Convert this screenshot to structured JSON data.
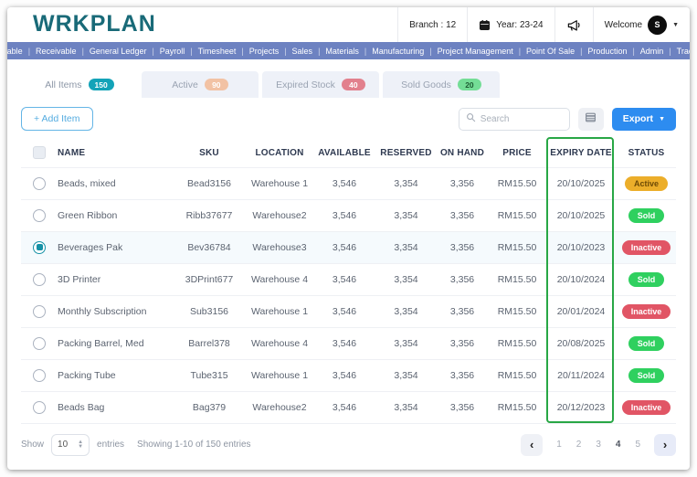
{
  "header": {
    "logo": "WRKPLAN",
    "branch": "Branch : 12",
    "year": "Year: 23-24",
    "welcome": "Welcome",
    "avatar_initial": "S"
  },
  "nav": {
    "items": [
      "Payable",
      "Receivable",
      "General Ledger",
      "Payroll",
      "Timesheet",
      "Projects",
      "Sales",
      "Materials",
      "Manufacturing",
      "Project Management",
      "Point Of Sale",
      "Production",
      "Admin",
      "Trading"
    ]
  },
  "tabs": [
    {
      "label": "All Items",
      "count": "150",
      "active": true,
      "badge_bg": "#13a3b8",
      "badge_fg": "#ffffff"
    },
    {
      "label": "Active",
      "count": "90",
      "active": false,
      "badge_bg": "#f2c2a4",
      "badge_fg": "#ffffff"
    },
    {
      "label": "Expired Stock",
      "count": "40",
      "active": false,
      "badge_bg": "#e2808d",
      "badge_fg": "#ffffff"
    },
    {
      "label": "Sold Goods",
      "count": "20",
      "active": false,
      "badge_bg": "#74dd96",
      "badge_fg": "#1d5c33"
    }
  ],
  "toolbar": {
    "add_item_label": "+ Add Item",
    "search_placeholder": "Search",
    "export_label": "Export"
  },
  "table": {
    "columns": [
      "NAME",
      "SKU",
      "LOCATION",
      "AVAILABLE",
      "RESERVED",
      "ON HAND",
      "PRICE",
      "EXPIRY DATE",
      "STATUS"
    ],
    "highlight_color": "#28a745",
    "status_styles": {
      "Active": {
        "bg": "#ecae2a",
        "fg": "#6d4a05"
      },
      "Sold": {
        "bg": "#2fd05f",
        "fg": "#ffffff"
      },
      "Inactive": {
        "bg": "#e15565",
        "fg": "#ffffff"
      }
    },
    "rows": [
      {
        "name": "Beads, mixed",
        "sku": "Bead3156",
        "location": "Warehouse 1",
        "available": "3,546",
        "reserved": "3,354",
        "on_hand": "3,356",
        "price": "RM15.50",
        "expiry": "20/10/2025",
        "status": "Active",
        "selected": false
      },
      {
        "name": "Green Ribbon",
        "sku": "Ribb37677",
        "location": "Warehouse2",
        "available": "3,546",
        "reserved": "3,354",
        "on_hand": "3,356",
        "price": "RM15.50",
        "expiry": "20/10/2025",
        "status": "Sold",
        "selected": false
      },
      {
        "name": "Beverages  Pak",
        "sku": "Bev36784",
        "location": "Warehouse3",
        "available": "3,546",
        "reserved": "3,354",
        "on_hand": "3,356",
        "price": "RM15.50",
        "expiry": "20/10/2023",
        "status": "Inactive",
        "selected": true
      },
      {
        "name": "3D Printer",
        "sku": "3DPrint677",
        "location": "Warehouse 4",
        "available": "3,546",
        "reserved": "3,354",
        "on_hand": "3,356",
        "price": "RM15.50",
        "expiry": "20/10/2024",
        "status": "Sold",
        "selected": false
      },
      {
        "name": "Monthly Subscription",
        "sku": "Sub3156",
        "location": "Warehouse 1",
        "available": "3,546",
        "reserved": "3,354",
        "on_hand": "3,356",
        "price": "RM15.50",
        "expiry": "20/01/2024",
        "status": "Inactive",
        "selected": false
      },
      {
        "name": "Packing Barrel, Med",
        "sku": "Barrel378",
        "location": "Warehouse 4",
        "available": "3,546",
        "reserved": "3,354",
        "on_hand": "3,356",
        "price": "RM15.50",
        "expiry": "20/08/2025",
        "status": "Sold",
        "selected": false
      },
      {
        "name": "Packing Tube",
        "sku": "Tube315",
        "location": "Warehouse 1",
        "available": "3,546",
        "reserved": "3,354",
        "on_hand": "3,356",
        "price": "RM15.50",
        "expiry": "20/11/2024",
        "status": "Sold",
        "selected": false
      },
      {
        "name": "Beads Bag",
        "sku": "Bag379",
        "location": "Warehouse2",
        "available": "3,546",
        "reserved": "3,354",
        "on_hand": "3,356",
        "price": "RM15.50",
        "expiry": "20/12/2023",
        "status": "Inactive",
        "selected": false
      }
    ]
  },
  "footer": {
    "show_label": "Show",
    "page_size": "10",
    "entries_label": "entries",
    "showing_text": "Showing 1-10 of 150 entries",
    "pages": [
      "1",
      "2",
      "3",
      "4",
      "5"
    ],
    "emphasized_page": "4",
    "prev_glyph": "‹",
    "next_glyph": "›"
  }
}
